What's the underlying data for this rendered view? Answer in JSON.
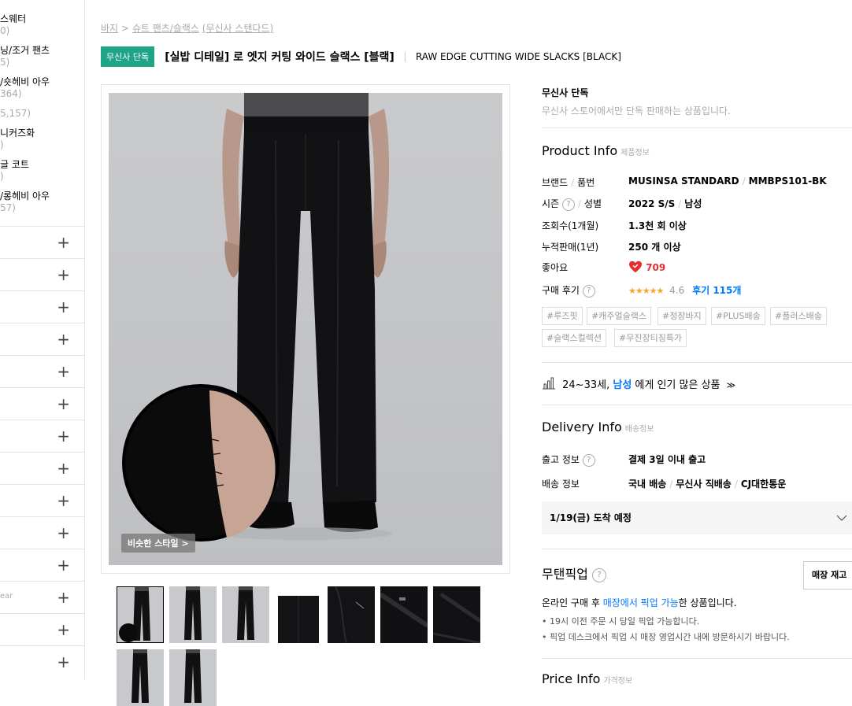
{
  "sidebar": {
    "categories": [
      {
        "label": "스웨터",
        "count": "0)"
      },
      {
        "label": "닝/조거 팬츠",
        "count": "5)"
      },
      {
        "label": "/숏헤비 아우",
        "count": "364)"
      },
      {
        "label": "",
        "count": "5,157)"
      },
      {
        "label": "니커즈화",
        "count": ")"
      },
      {
        "label": "글 코트",
        "count": ")"
      },
      {
        "label": "/롱헤비 아우",
        "count": "57)"
      }
    ],
    "collapsed_rows": [
      "",
      "",
      "",
      "",
      "",
      "",
      "",
      "",
      "",
      "",
      "ear",
      "",
      ""
    ]
  },
  "breadcrumb": {
    "a": "바지",
    "sep": ">",
    "b": "슈트 팬츠/슬랙스",
    "c": "(무신사 스탠다드)"
  },
  "product": {
    "badge": "무신사 단독",
    "title_ko": "[실밥 디테일] 로 엣지 커팅 와이드 슬랙스 [블랙]",
    "title_en": "RAW EDGE CUTTING WIDE SLACKS [BLACK]",
    "similar_style": "비슷한 스타일 >"
  },
  "exclusive": {
    "title": "무신사 단독",
    "desc": "무신사 스토어에서만 단독 판매하는 상품입니다."
  },
  "product_info": {
    "title": "Product Info",
    "sub": "제품정보",
    "rows": [
      {
        "k1": "브랜드",
        "k2": "품번",
        "v1": "MUSINSA STANDARD",
        "v2": "MMBPS101-BK"
      },
      {
        "k1": "시즌",
        "k2": "성별",
        "v1": "2022 S/S",
        "v2": "남성"
      },
      {
        "k1": "조회수(1개월)",
        "v1": "1.3천 회 이상"
      },
      {
        "k1": "누적판매(1년)",
        "v1": "250 개 이상"
      }
    ],
    "likes_label": "좋아요",
    "likes": "709",
    "review_label": "구매 후기",
    "rating": "4.6",
    "review_count": "후기 115개",
    "stars": "★★★★★",
    "tags": [
      "#루즈핏",
      "#캐주얼슬랙스",
      "#정장바지",
      "#PLUS배송",
      "#플러스배송",
      "#슬랙스컬렉션",
      "#무진장티징특가"
    ],
    "popular_pre": "24~33세,",
    "popular_gender": "남성",
    "popular_post": "에게 인기 많은 상품"
  },
  "delivery_info": {
    "title": "Delivery Info",
    "sub": "배송정보",
    "ship_label": "출고 정보",
    "ship_value": "결제 3일 이내 출고",
    "method_label": "배송 정보",
    "method_1": "국내 배송",
    "method_2": "무신사 직배송",
    "method_3": "CJ대한통운",
    "arrival": "1/19(금) 도착 예정"
  },
  "pickup": {
    "title": "무탠픽업",
    "store_button": "매장 재고",
    "desc_pre": "온라인 구매 후",
    "desc_hl": "매장에서 픽업 가능",
    "desc_post": "한 상품입니다.",
    "bullets": [
      "19시 이전 주문 시 당일 픽업 가능합니다.",
      "픽업 데스크에서 픽업 시 매장 영업시간 내에 방문하시기 바랍니다."
    ]
  },
  "price_info": {
    "title": "Price Info",
    "sub": "가격정보"
  },
  "colors": {
    "accent_green": "#1fa487",
    "link_blue": "#0078ff",
    "heart_red": "#e62e2e",
    "star_orange": "#f5a623"
  }
}
